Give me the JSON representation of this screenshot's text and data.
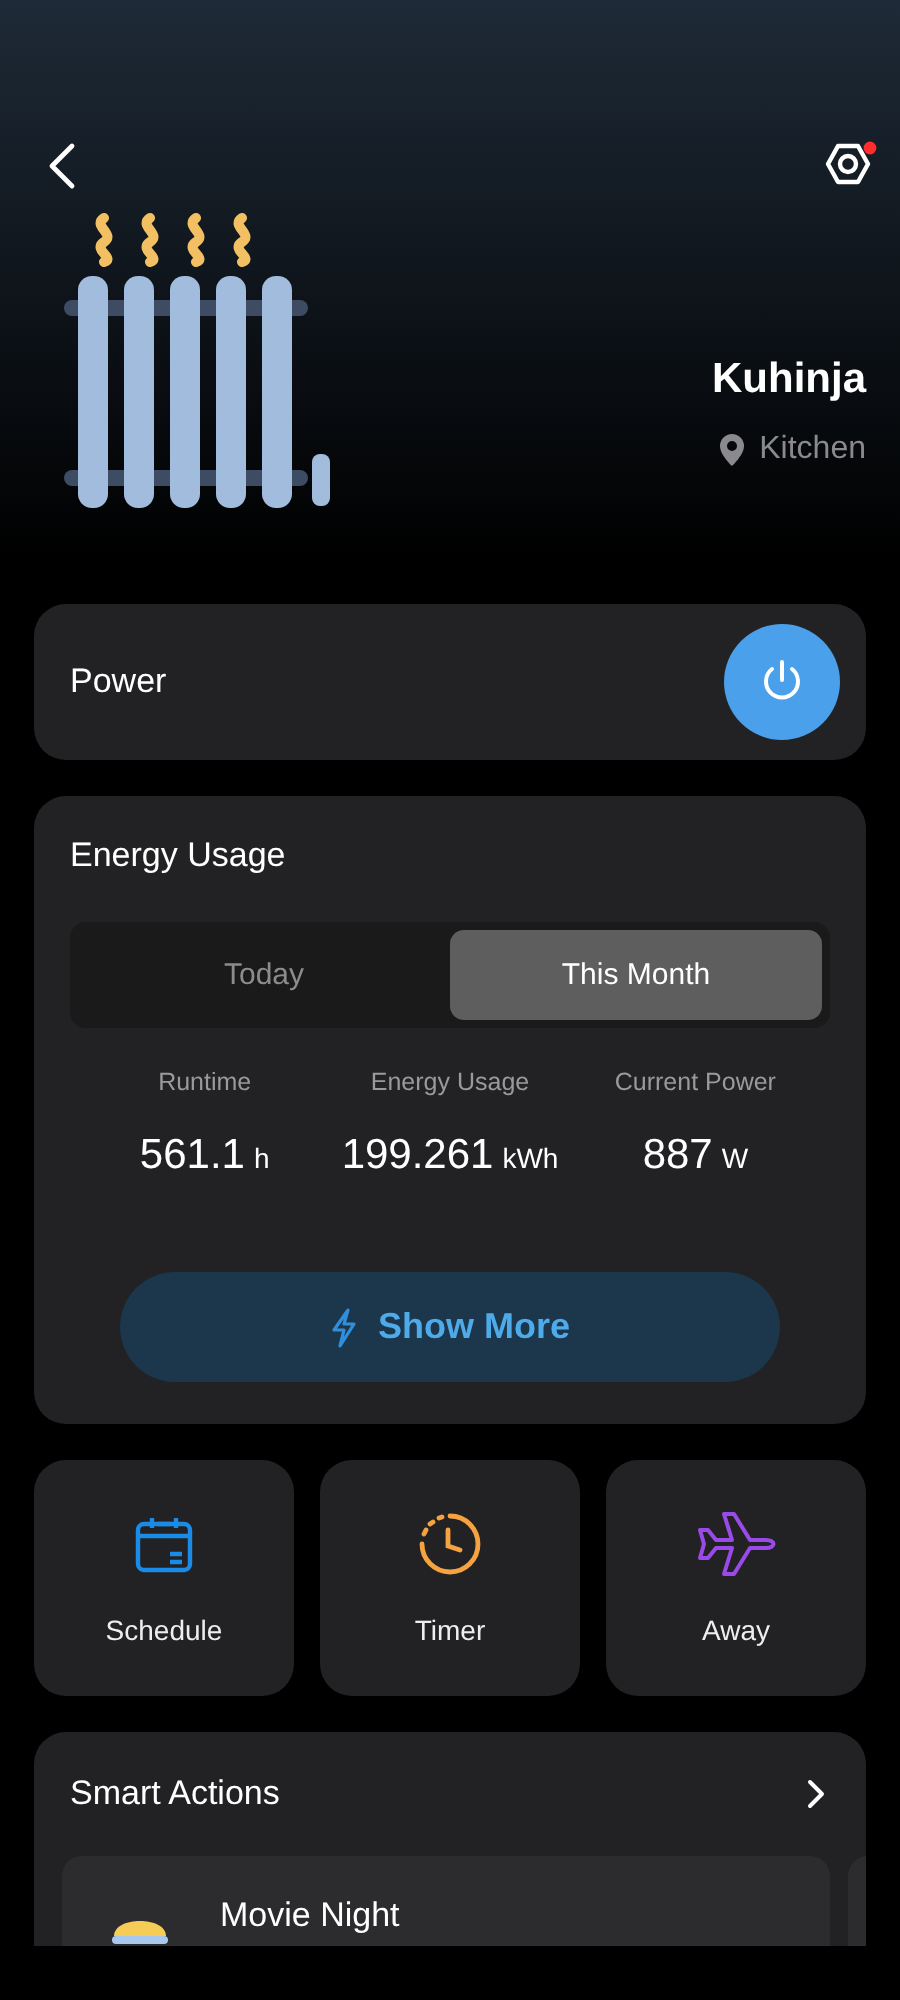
{
  "header": {
    "name": "Kuhinja",
    "location": "Kitchen",
    "settings_badge": true
  },
  "power": {
    "label": "Power",
    "on": true
  },
  "energy": {
    "title": "Energy Usage",
    "tabs": [
      {
        "label": "Today",
        "selected": false
      },
      {
        "label": "This Month",
        "selected": true
      }
    ],
    "stats": [
      {
        "label": "Runtime",
        "value": "561.1",
        "unit": "h"
      },
      {
        "label": "Energy Usage",
        "value": "199.261",
        "unit": "kWh"
      },
      {
        "label": "Current Power",
        "value": "887",
        "unit": "W"
      }
    ],
    "button": "Show More"
  },
  "tiles": [
    {
      "kind": "schedule",
      "label": "Schedule"
    },
    {
      "kind": "timer",
      "label": "Timer"
    },
    {
      "kind": "away",
      "label": "Away"
    }
  ],
  "smart_actions": {
    "title": "Smart Actions",
    "items": [
      {
        "name": "Movie Night"
      }
    ]
  }
}
